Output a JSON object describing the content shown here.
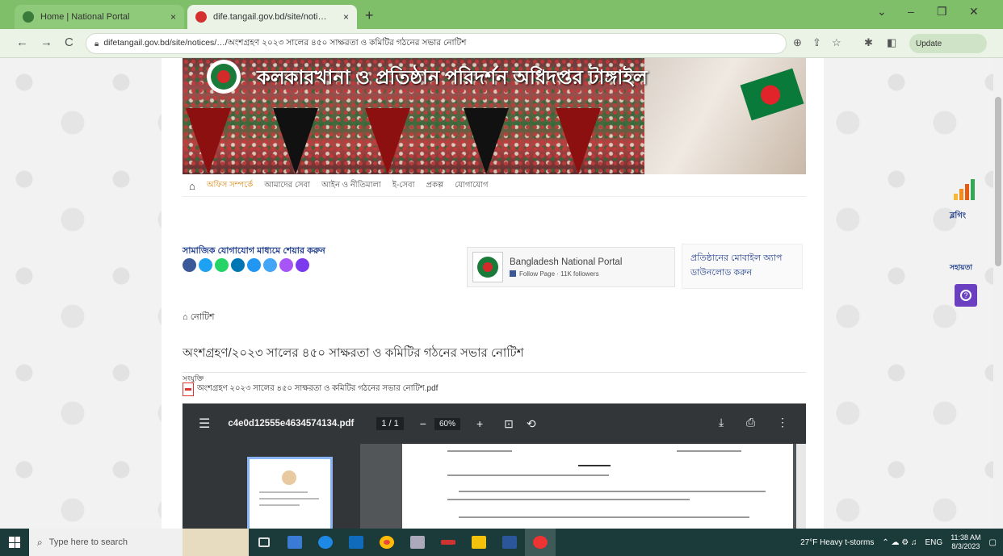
{
  "browser": {
    "tabs": [
      {
        "title": "Home | National Portal",
        "close": "×"
      },
      {
        "title": "dife.tangail.gov.bd/site/noti…",
        "close": "×"
      }
    ],
    "new_tab": "+",
    "window_controls": {
      "chevron": "⌄",
      "minimize": "–",
      "maximize": "❐",
      "close": "✕"
    },
    "nav": {
      "back": "←",
      "forward": "→",
      "reload": "C"
    },
    "url": "difetangail.gov.bd/site/notices/…/অংশগ্রহণ ২০২৩ সালের ৪৫০ সাক্ষরতা ও কমিটির গঠনের সভার নোটিশ",
    "toolbar_icons": {
      "zoom": "⊕",
      "share": "⇪",
      "star": "☆",
      "ext": "✱",
      "side": "◧"
    },
    "profile": "Update"
  },
  "site": {
    "title": "কলকারখানা ও প্রতিষ্ঠান পরিদর্শন অধিদপ্তর টাঙ্গাইল",
    "menu": {
      "home_icon": "⌂",
      "items": [
        "অফিস সম্পর্কে",
        "আমাদের সেবা",
        "আইন ও নীতিমালা",
        "ই-সেবা",
        "প্রকল্প",
        "যোগাযোগ"
      ]
    }
  },
  "social": {
    "label": "সামাজিক যোগাযোগ মাধ্যমে শেয়ার করুন",
    "icons": [
      {
        "name": "facebook-icon",
        "color": "#3b5998"
      },
      {
        "name": "twitter-icon",
        "color": "#1da1f2"
      },
      {
        "name": "whatsapp-icon",
        "color": "#25d366"
      },
      {
        "name": "linkedin-icon",
        "color": "#0077b5"
      },
      {
        "name": "email-icon",
        "color": "#2196f3"
      },
      {
        "name": "print-icon",
        "color": "#42a5f5"
      },
      {
        "name": "messenger-icon",
        "color": "#a855f7"
      },
      {
        "name": "share-icon",
        "color": "#7c3aed"
      }
    ]
  },
  "fb_widget": {
    "page_name": "Bangladesh National Portal",
    "meta": "Follow Page · 11K followers"
  },
  "mobile_link": "প্রতিষ্ঠানের মোবাইল অ্যাপ ডাউনলোড করুন",
  "breadcrumb": "⌂ নোটিশ",
  "notice": {
    "title": "অংশগ্রহণ/২০২৩ সালের ৪৫০ সাক্ষরতা ও কমিটির গঠনের সভার নোটিশ",
    "attachment_label": "সংযুক্তি",
    "attachment_name": "অংশগ্রহণ ২০২৩ সালের ৪৫০ সাক্ষরতা ও কমিটির গঠনের সভার নোটিশ.pdf"
  },
  "pdf_viewer": {
    "menu": "☰",
    "filename": "c4e0d12555e4634574134.pdf",
    "page": "1 / 1",
    "zoom_out": "−",
    "zoom_value": "60%",
    "zoom_in": "+",
    "fit": "⊡",
    "rotate": "⟲",
    "download": "⤓",
    "print": "⎙",
    "more": "⋮"
  },
  "right_sidebar": {
    "stats_label": "ব্লগিং",
    "text2": "সহায়তা",
    "help": "?",
    "bar_colors": [
      "#f7b733",
      "#f38b1e",
      "#e55b13",
      "#34a853"
    ]
  },
  "taskbar": {
    "search_placeholder": "Type here to search",
    "weather": "27°F  Heavy t-storms",
    "lang": "ENG",
    "time": "11:38 AM",
    "date": "8/3/2023"
  }
}
